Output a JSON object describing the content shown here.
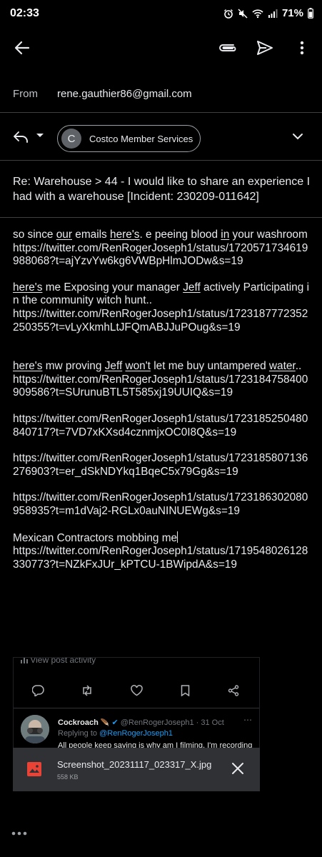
{
  "status_bar": {
    "time": "02:33",
    "battery": "71%"
  },
  "toolbar": {
    "back_icon": "arrow-back-icon",
    "attach_icon": "paperclip-icon",
    "send_icon": "send-icon",
    "more_icon": "more-vert-icon"
  },
  "compose": {
    "from_label": "From",
    "from_value": "rene.gauthier86@gmail.com",
    "recipient_initial": "C",
    "recipient_name": "Costco Member Services",
    "subject": "Re: Warehouse > 44 - I would like to share an experience I had with a warehouse [Incident: 230209-011642]"
  },
  "body": {
    "p1_a": "so since ",
    "p1_our": "our",
    "p1_b": " emails ",
    "p1_heres": "here's",
    "p1_c": ". e peeing blood ",
    "p1_in": "in",
    "p1_d": " your washroom",
    "p1_link": "https://twitter.com/RenRogerJoseph1/status/1720571734619988068?t=ajYzvYw6kg6VWBpHlmJODw&s=19",
    "p2_heres": "here's",
    "p2_a": " me Exposing your manager ",
    "p2_jeff": "Jeff",
    "p2_b": " actively Participating in the community witch hunt..",
    "p2_link": "https://twitter.com/RenRogerJoseph1/status/1723187772352250355?t=vLyXkmhLtJFQmABJJuPOug&s=19",
    "p3_heres": "here's",
    "p3_a": " mw proving ",
    "p3_jeff": "Jeff",
    "p3_b": " ",
    "p3_wont": "won't",
    "p3_c": " let me buy untampered ",
    "p3_water": "water",
    "p3_d": "..",
    "p3_link": "https://twitter.com/RenRogerJoseph1/status/1723184758400909586?t=SUrunuBTL5T585xj19UUIQ&s=19",
    "link4": "https://twitter.com/RenRogerJoseph1/status/1723185250480840717?t=7VD7xKXsd4cznmjxOC0I8Q&s=19",
    "link5": "https://twitter.com/RenRogerJoseph1/status/1723185807136276903?t=er_dSkNDYkq1BqeC5x79Gg&s=19",
    "link6": "https://twitter.com/RenRogerJoseph1/status/1723186302080958935?t=m1dVaj2-RGLx0auNINUEWg&s=19",
    "p7_text": "Mexican Contractors mobbing me",
    "p7_link": "https://twitter.com/RenRogerJoseph1/status/1719548026128330773?t=NZkFxJUr_kPTCU-1BWipdA&s=19"
  },
  "preview": {
    "activity": "View post activity",
    "tweet_name": "Cockroach",
    "tweet_handle": "@RenRogerJoseph1 · 31 Oct",
    "replying_prefix": "Replying to ",
    "replying_handle": "@RenRogerJoseph1",
    "tweet_text": "All people keep saying is why am I filming, I'm recording domestic Terrorists and it shows how hungry y'all are for"
  },
  "attachment": {
    "filename": "Screenshot_20231117_023317_X.jpg",
    "size": "558 KB"
  },
  "colors": {
    "background": "#000000",
    "surface": "#303134",
    "text": "#e8eaed",
    "muted": "#9aa0a6",
    "link_blue": "#1d9bf0",
    "attachment_red": "#ea4335"
  }
}
